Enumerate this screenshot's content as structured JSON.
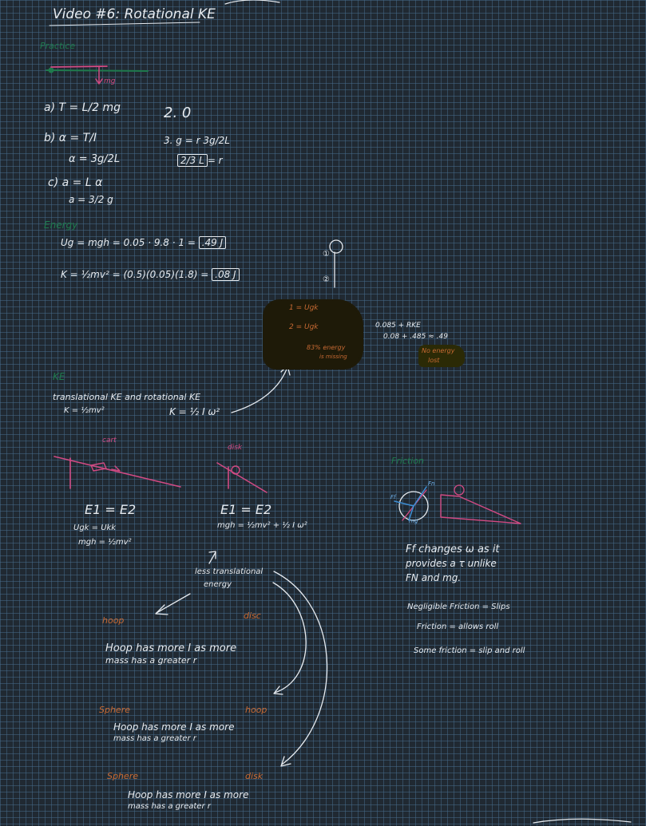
{
  "header": {
    "title": "Video #6: Rotational KE"
  },
  "practice1": {
    "label": "Practice",
    "mg_label": "mg",
    "a": "a) T = L/2 mg",
    "b1": "b) α = T/I",
    "b2": "α = 3g/2L",
    "c1": "c) a = L α",
    "c2": "a = 3/2 g",
    "n2": "2. 0",
    "n3": "3. g = r 3g/2L",
    "n3_ans": "2/3 L",
    "n3_tail": "= r"
  },
  "energy": {
    "label": "Energy",
    "line1": "Ug = mgh = 0.05 · 9.8 · 1 =",
    "line1_ans": ".49 J",
    "line2": "K = ½mv² = (0.5)(0.05)(1.8) =",
    "line2_ans": ".08 J",
    "pend_1": "①",
    "pend_2": "②",
    "blob_1": "1 = Ugk",
    "blob_2": "2 = Ugk",
    "blob_3": "83% energy",
    "blob_4": "is missing",
    "calc1": "0.085 + RKE",
    "calc2": "0.08 + .485 ≈ .49",
    "no_energy_1": "No energy",
    "no_energy_2": "lost"
  },
  "ke": {
    "label": "KE",
    "line1": "translational KE and rotational KE",
    "trans": "K = ½mv²",
    "rot": "K = ½ I ω²"
  },
  "ramps": {
    "cart_label": "cart",
    "disk_label": "disk",
    "e1": "E1 = E2",
    "e1_a": "Ugk = Ukk",
    "e1_b": "mgh = ½mv²",
    "e2": "E1 = E2",
    "e2_a": "mgh = ½mv² + ½ I ω²",
    "less_1": "less translational",
    "less_2": "energy"
  },
  "compare": {
    "hoop_1": "hoop",
    "disc_1": "disc",
    "text1_a": "Hoop has more I as more",
    "text1_b": "mass has a greater r",
    "sphere_2": "Sphere",
    "hoop_2": "hoop",
    "text2_a": "Hoop has more I as more",
    "text2_b": "mass has a greater r",
    "sphere_3": "Sphere",
    "disk_3": "disk",
    "text3_a": "Hoop has more I as more",
    "text3_b": "mass has a greater r"
  },
  "friction": {
    "label": "Friction",
    "ff_label": "Ff",
    "fn_label": "Fn",
    "mg_label": "mg",
    "text1": "Ff changes ω as it",
    "text2": "provides a τ unlike",
    "text3": "FN and mg.",
    "neg": "Negligible Friction = Slips",
    "fric": "Friction = allows roll",
    "some": "Some friction = slip and roll"
  }
}
